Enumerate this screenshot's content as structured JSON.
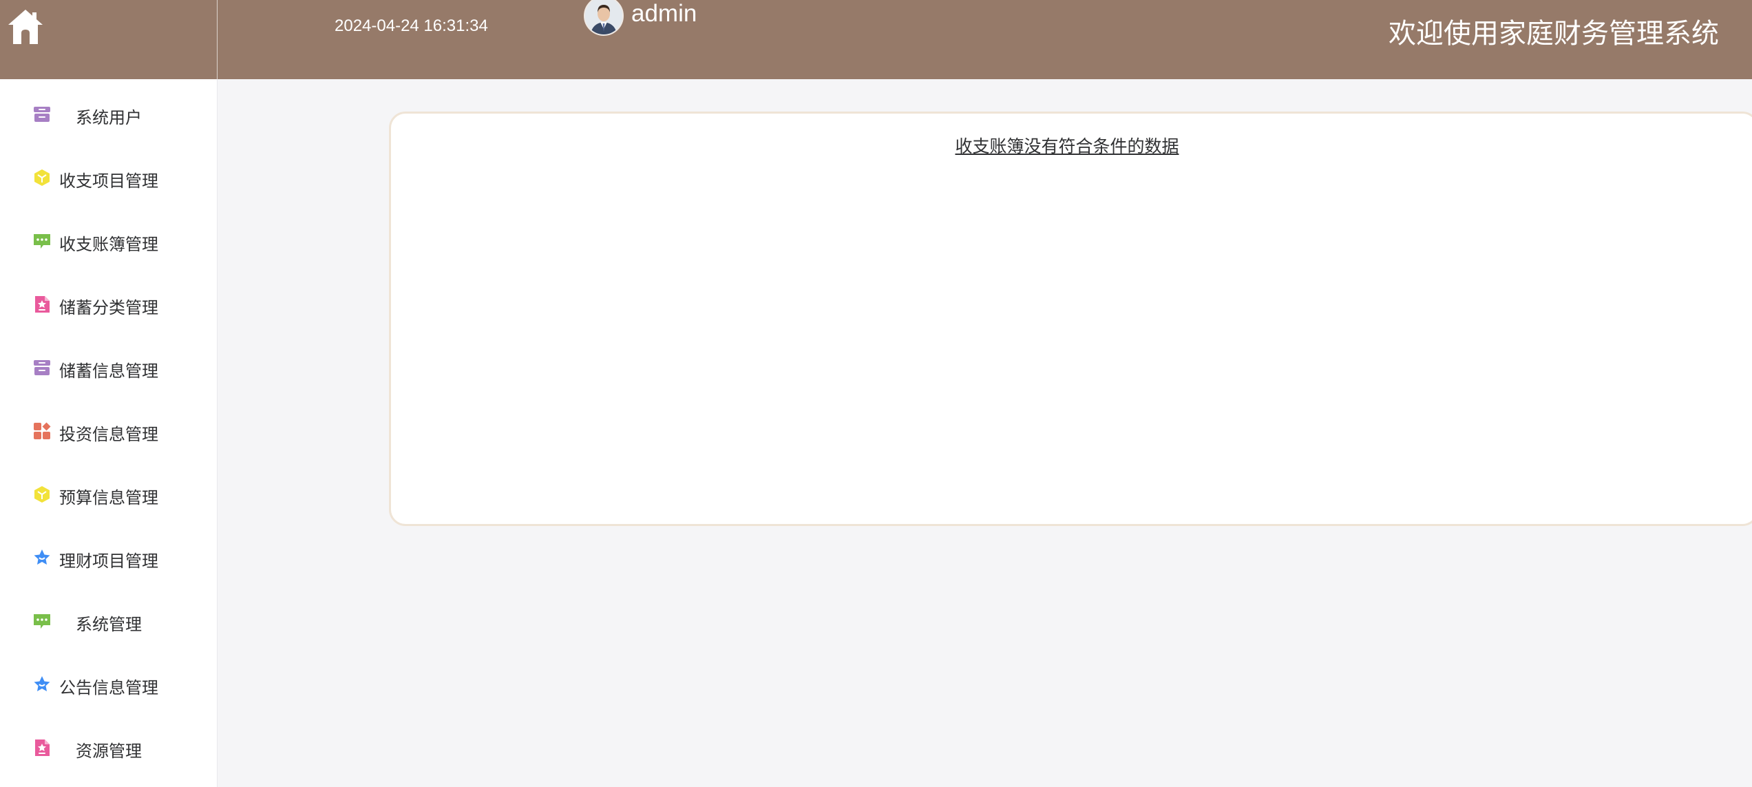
{
  "header": {
    "datetime": "2024-04-24 16:31:34",
    "username": "admin",
    "title": "欢迎使用家庭财务管理系统",
    "home_icon": "home-icon",
    "colors": {
      "bar": "#967a69",
      "text": "#ffffff"
    }
  },
  "sidebar": {
    "items": [
      {
        "label": "系统用户",
        "icon": "archive-icon",
        "color": "#a77fc4"
      },
      {
        "label": "收支项目管理",
        "icon": "cube-icon",
        "color": "#f2e23a"
      },
      {
        "label": "收支账簿管理",
        "icon": "chat-icon",
        "color": "#79bf4a"
      },
      {
        "label": "储蓄分类管理",
        "icon": "document-icon",
        "color": "#e95a9c"
      },
      {
        "label": "储蓄信息管理",
        "icon": "archive-icon",
        "color": "#a77fc4"
      },
      {
        "label": "投资信息管理",
        "icon": "apps-icon",
        "color": "#e5735c"
      },
      {
        "label": "预算信息管理",
        "icon": "cube-icon",
        "color": "#f2e23a"
      },
      {
        "label": "理财项目管理",
        "icon": "star-badge-icon",
        "color": "#3f8ef5"
      },
      {
        "label": "系统管理",
        "icon": "chat-icon",
        "color": "#79bf4a"
      },
      {
        "label": "公告信息管理",
        "icon": "star-badge-icon",
        "color": "#3f8ef5"
      },
      {
        "label": "资源管理",
        "icon": "document-icon",
        "color": "#e95a9c"
      }
    ]
  },
  "main": {
    "empty_message": "收支账簿没有符合条件的数据"
  }
}
